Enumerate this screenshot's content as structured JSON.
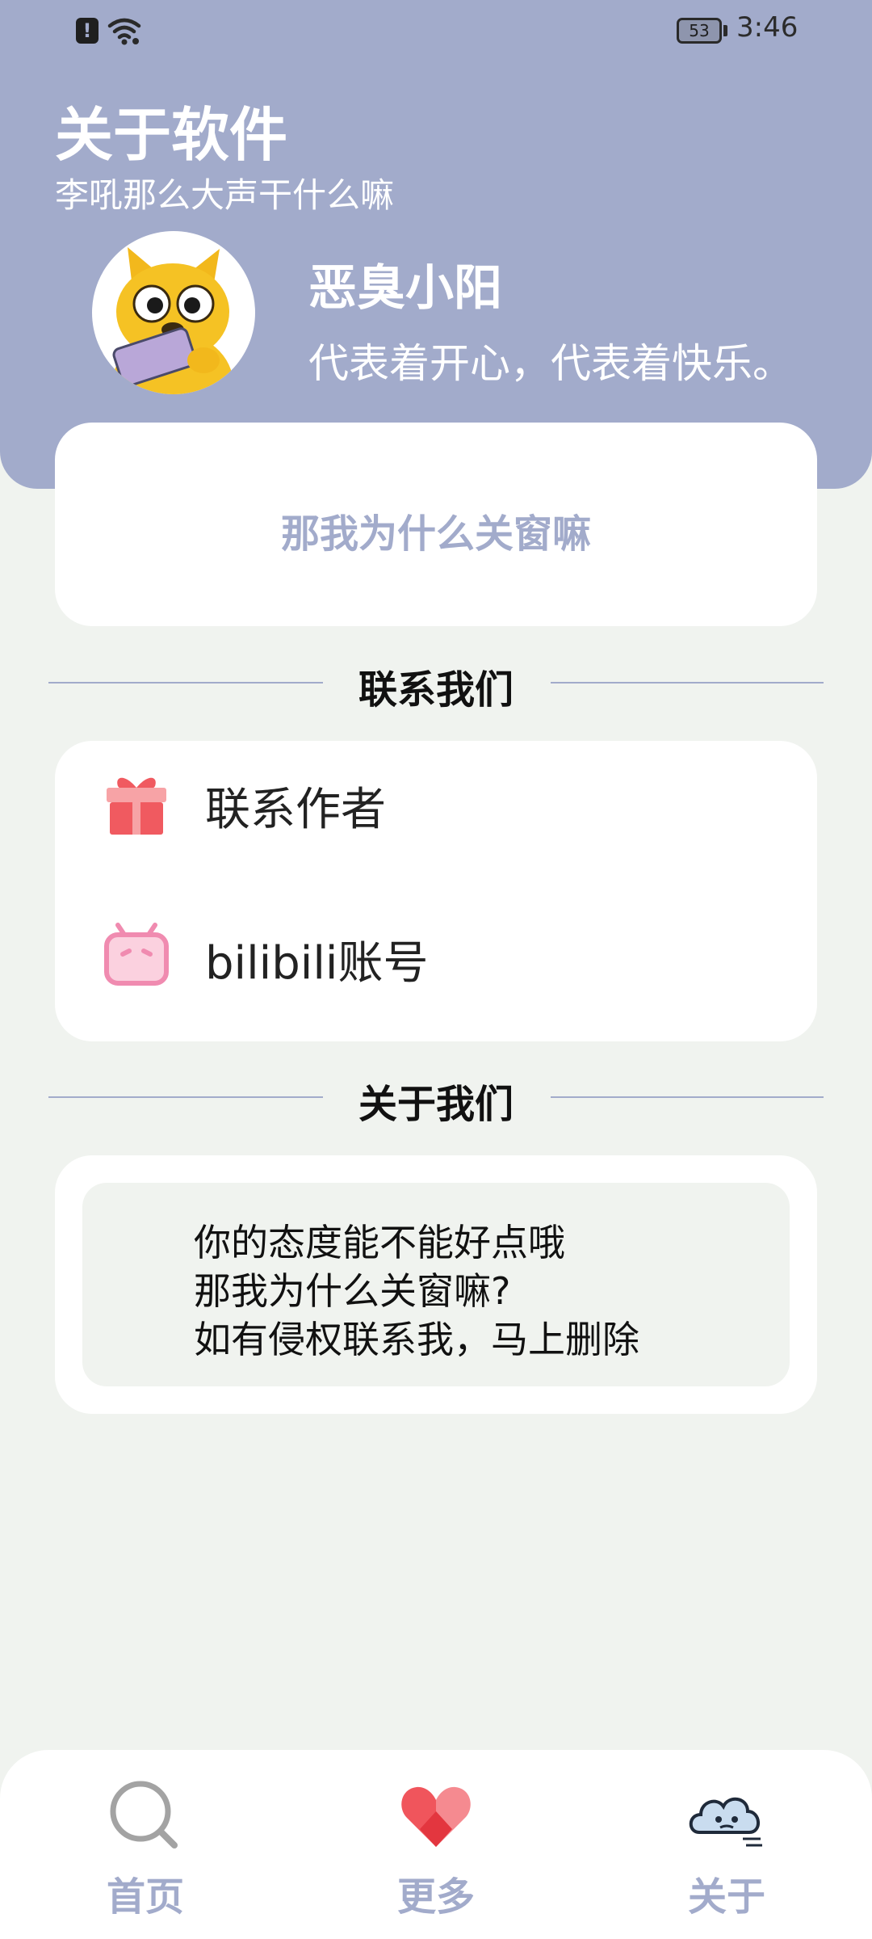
{
  "status_bar": {
    "battery": "53",
    "time": "3:46"
  },
  "header": {
    "title": "关于软件",
    "subtitle": "李吼那么大声干什么嘛",
    "profile": {
      "name": "恶臭小阳",
      "motto": "代表着开心，代表着快乐。"
    }
  },
  "quote_card": {
    "text": "那我为什么关窗嘛"
  },
  "contact_section": {
    "title": "联系我们",
    "items": [
      {
        "label": "联系作者",
        "icon": "gift-icon"
      },
      {
        "label": "bilibili账号",
        "icon": "bilibili-tv-icon"
      }
    ]
  },
  "about_section": {
    "title": "关于我们",
    "lines": [
      "你的态度能不能好点哦",
      "那我为什么关窗嘛?",
      "如有侵权联系我，马上删除"
    ]
  },
  "bottom_nav": [
    {
      "label": "首页",
      "icon": "search-icon"
    },
    {
      "label": "更多",
      "icon": "heart-icon"
    },
    {
      "label": "关于",
      "icon": "cloud-icon"
    }
  ],
  "colors": {
    "accent": "#a2abcb",
    "background": "#f0f3ef",
    "card": "#ffffff",
    "gift": "#f05a60",
    "bilibili": "#f08bb0"
  }
}
